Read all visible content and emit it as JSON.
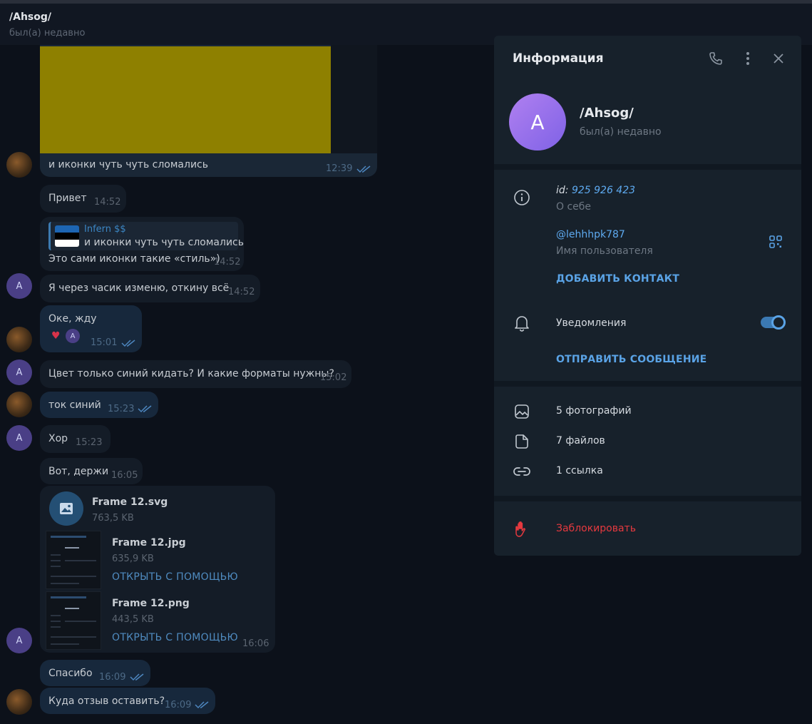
{
  "chat": {
    "title": "/Ahsog/",
    "status": "был(а) недавно",
    "messages": {
      "m1": {
        "text": "и иконки чуть чуть сломались",
        "time": "12:39"
      },
      "m2": {
        "text": "Привет",
        "time": "14:52"
      },
      "m3": {
        "reply_name": "Infern $$",
        "reply_text": "и иконки чуть чуть сломались",
        "text": "Это сами иконки такие «стиль»)",
        "time": "14:52"
      },
      "m4": {
        "text": "Я через часик изменю, откину всё",
        "time": "14:52"
      },
      "m5": {
        "text": "Оке, жду",
        "time": "15:01",
        "reaction": "❤️",
        "reaction_avatar": "A"
      },
      "m6": {
        "text": "Цвет только синий кидать? И какие форматы нужны?",
        "time": "15:02"
      },
      "m7": {
        "text": "ток синий",
        "time": "15:23"
      },
      "m8": {
        "text": "Хор",
        "time": "15:23"
      },
      "m9": {
        "text": "Вот, держи",
        "time": "16:05"
      },
      "files": {
        "f1": {
          "name": "Frame 12.svg",
          "size": "763,5 KB"
        },
        "f2": {
          "name": "Frame 12.jpg",
          "size": "635,9 KB",
          "action": "ОТКРЫТЬ С ПОМОЩЬЮ"
        },
        "f3": {
          "name": "Frame 12.png",
          "size": "443,5 KB",
          "action": "ОТКРЫТЬ С ПОМОЩЬЮ"
        },
        "time": "16:06"
      },
      "m10": {
        "text": "Спасибо",
        "time": "16:09"
      },
      "m11": {
        "text": "Куда отзыв оставить?",
        "time": "16:09"
      }
    },
    "avatar_letter": "A"
  },
  "panel": {
    "title": "Информация",
    "avatar_letter": "A",
    "name": "/Ahsog/",
    "status": "был(а) недавно",
    "id_prefix": "id:",
    "id_value": "925 926 423",
    "about_label": "О себе",
    "username": "@lehhhpk787",
    "username_label": "Имя пользователя",
    "add_contact": "ДОБАВИТЬ КОНТАКТ",
    "notifications_label": "Уведомления",
    "notifications_on": true,
    "send_message": "ОТПРАВИТЬ СООБЩЕНИЕ",
    "photos": "5 фотографий",
    "files": "7 файлов",
    "links": "1 ссылка",
    "block": "Заблокировать"
  },
  "colors": {
    "background": "#0c111a",
    "panel": "#17212b",
    "accent": "#5aa3e6",
    "danger": "#e5393f",
    "avatar_gradient_start": "#b080f0",
    "avatar_gradient_end": "#7f62e6"
  },
  "icons": [
    "phone-icon",
    "more-vertical-icon",
    "close-icon",
    "info-icon",
    "qr-code-icon",
    "bell-icon",
    "photo-icon",
    "file-icon",
    "link-icon",
    "hand-block-icon",
    "image-file-icon",
    "double-check-icon"
  ]
}
